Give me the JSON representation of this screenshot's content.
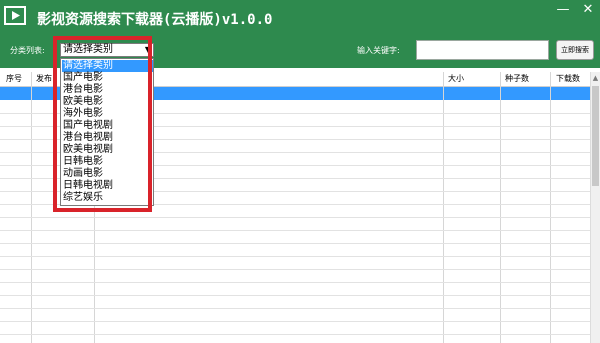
{
  "app": {
    "title": "影视资源搜索下载器(云播版)v1.0.0",
    "icon": "film-clapper-icon",
    "minimize_label": "—",
    "close_label": "✕",
    "accent_color": "#2e8a4e",
    "highlight_color": "#d9232a"
  },
  "toolbar": {
    "category_label": "分类列表:",
    "category_selected": "请选择类别",
    "keyword_label": "输入关键字:",
    "keyword_value": "",
    "search_button": "立即搜索"
  },
  "dropdown": {
    "options": [
      "请选择类别",
      "国产电影",
      "港台电影",
      "欧美电影",
      "海外电影",
      "国产电视剧",
      "港台电视剧",
      "欧美电视剧",
      "日韩电影",
      "动画电影",
      "日韩电视剧",
      "综艺娱乐"
    ],
    "selected_index": 0
  },
  "table": {
    "columns": [
      "序号",
      "发布",
      "大小",
      "种子数",
      "下载数"
    ],
    "rows": []
  }
}
